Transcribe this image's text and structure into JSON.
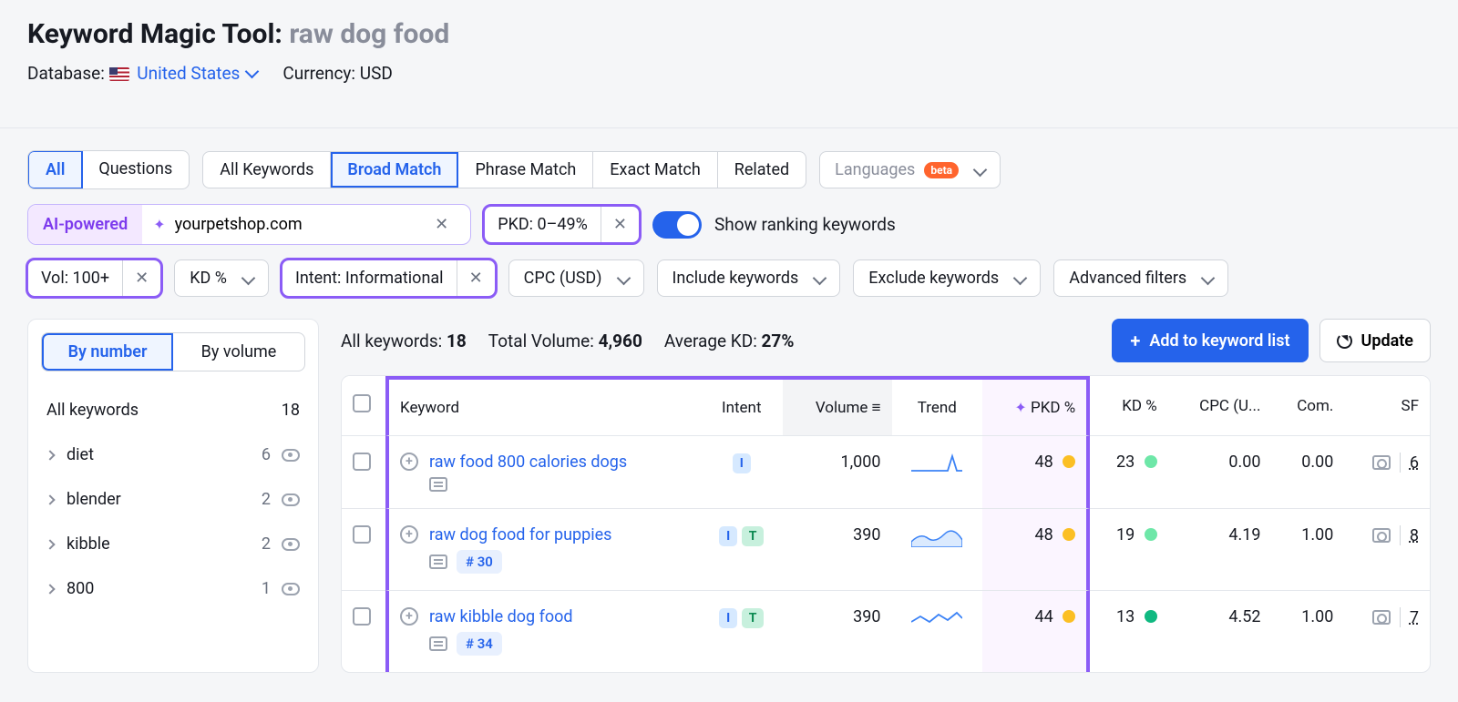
{
  "header": {
    "tool_name": "Keyword Magic Tool:",
    "query": "raw dog food",
    "database_label": "Database:",
    "database_value": "United States",
    "currency_label": "Currency:",
    "currency_value": "USD"
  },
  "tabs_scope": {
    "all": "All",
    "questions": "Questions"
  },
  "tabs_match": {
    "all_kw": "All Keywords",
    "broad": "Broad Match",
    "phrase": "Phrase Match",
    "exact": "Exact Match",
    "related": "Related"
  },
  "lang_filter": {
    "label": "Languages",
    "badge": "beta"
  },
  "ai": {
    "tag": "AI-powered",
    "domain": "yourpetshop.com"
  },
  "filters": {
    "pkd": "PKD: 0–49%",
    "toggle_label": "Show ranking keywords",
    "vol": "Vol: 100+",
    "kd": "KD %",
    "intent": "Intent: Informational",
    "cpc": "CPC (USD)",
    "include": "Include keywords",
    "exclude": "Exclude keywords",
    "advanced": "Advanced filters"
  },
  "sidebar": {
    "by_number": "By number",
    "by_volume": "By volume",
    "all_label": "All keywords",
    "all_count": "18",
    "groups": [
      {
        "name": "diet",
        "count": "6"
      },
      {
        "name": "blender",
        "count": "2"
      },
      {
        "name": "kibble",
        "count": "2"
      },
      {
        "name": "800",
        "count": "1"
      }
    ]
  },
  "stats": {
    "all_kw_label": "All keywords:",
    "all_kw_val": "18",
    "total_vol_label": "Total Volume:",
    "total_vol_val": "4,960",
    "avg_kd_label": "Average KD:",
    "avg_kd_val": "27%"
  },
  "buttons": {
    "add": "Add to keyword list",
    "update": "Update"
  },
  "table": {
    "headers": {
      "keyword": "Keyword",
      "intent": "Intent",
      "volume": "Volume",
      "trend": "Trend",
      "pkd": "PKD %",
      "kd": "KD %",
      "cpc": "CPC (U...",
      "com": "Com.",
      "sf": "SF"
    },
    "rows": [
      {
        "keyword": "raw food 800 calories dogs",
        "intents": [
          "I"
        ],
        "rank": null,
        "volume": "1,000",
        "pkd": "48",
        "pkd_color": "y",
        "kd": "23",
        "kd_color": "g",
        "cpc": "0.00",
        "com": "0.00",
        "sf": "6"
      },
      {
        "keyword": "raw dog food for puppies",
        "intents": [
          "I",
          "T"
        ],
        "rank": "# 30",
        "volume": "390",
        "pkd": "48",
        "pkd_color": "y",
        "kd": "19",
        "kd_color": "g",
        "cpc": "4.19",
        "com": "1.00",
        "sf": "8"
      },
      {
        "keyword": "raw kibble dog food",
        "intents": [
          "I",
          "T"
        ],
        "rank": "# 34",
        "volume": "390",
        "pkd": "44",
        "pkd_color": "y",
        "kd": "13",
        "kd_color": "dg",
        "cpc": "4.52",
        "com": "1.00",
        "sf": "7"
      }
    ]
  },
  "chart_data": {
    "type": "table",
    "title": "Keyword Magic Tool results for 'raw dog food'",
    "columns": [
      "Keyword",
      "Intent",
      "Volume",
      "PKD %",
      "KD %",
      "CPC (USD)",
      "Com.",
      "SF"
    ],
    "rows": [
      [
        "raw food 800 calories dogs",
        "I",
        1000,
        48,
        23,
        0.0,
        0.0,
        6
      ],
      [
        "raw dog food for puppies",
        "I,T",
        390,
        48,
        19,
        4.19,
        1.0,
        8
      ],
      [
        "raw kibble dog food",
        "I,T",
        390,
        44,
        13,
        4.52,
        1.0,
        7
      ]
    ]
  }
}
